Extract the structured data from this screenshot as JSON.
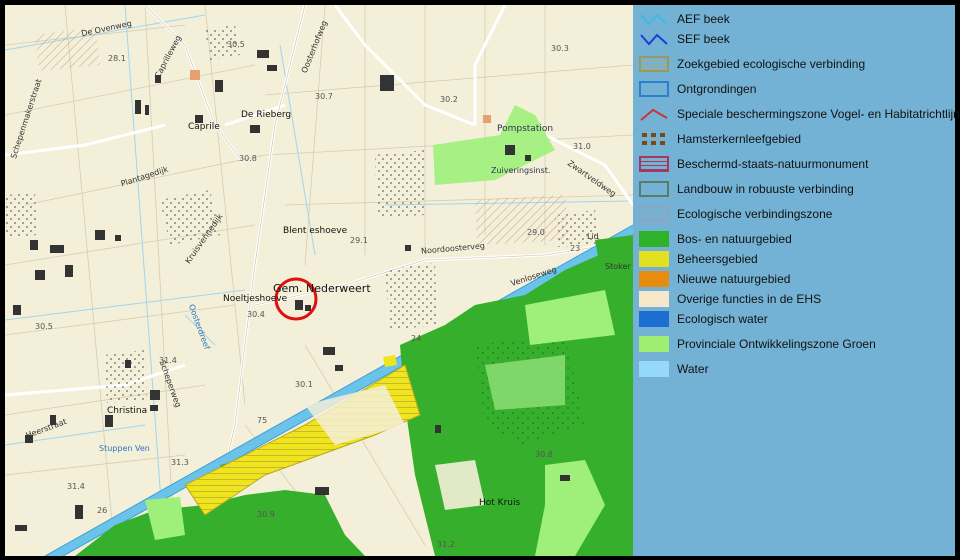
{
  "map": {
    "place_labels": [
      {
        "id": "ovenweg",
        "text": "De Ovenweg"
      },
      {
        "id": "caprilleweg",
        "text": "Caprilleweg"
      },
      {
        "id": "oosterhofweg",
        "text": "Oosterhofweg"
      },
      {
        "id": "schepenmakerstraat",
        "text": "Schepenmakerstraat"
      },
      {
        "id": "caprile",
        "text": "Caprile"
      },
      {
        "id": "rieberg",
        "text": "De Rieberg"
      },
      {
        "id": "pompstation",
        "text": "Pompstation"
      },
      {
        "id": "zuiverigs",
        "text": "Zuiveringsinst."
      },
      {
        "id": "zwartveld",
        "text": "Zwartveldweg"
      },
      {
        "id": "plantagedijk",
        "text": "Plantagedijk"
      },
      {
        "id": "blenteshoeve",
        "text": "Blent eshoeve"
      },
      {
        "id": "noordoosterveg",
        "text": "Noordoosterveg"
      },
      {
        "id": "kruisvennedijk",
        "text": "Kruisvennedijk"
      },
      {
        "id": "noeltjeshoeve",
        "text": "Noeltjeshoeve"
      },
      {
        "id": "venlosesweg",
        "text": "Venloseweg"
      },
      {
        "id": "stokers",
        "text": "Stoker"
      },
      {
        "id": "oosterdreef",
        "text": "Oosterdreef"
      },
      {
        "id": "scheperweg",
        "text": "Scheperweg"
      },
      {
        "id": "christina",
        "text": "Christina"
      },
      {
        "id": "stuppen",
        "text": "Stuppen Ven"
      },
      {
        "id": "hotkruis",
        "text": "Hot Kruis"
      },
      {
        "id": "heerstraat",
        "text": "Heerstraat"
      },
      {
        "id": "lid",
        "text": "Lid"
      }
    ],
    "elevations": [
      "28.1",
      "30.5",
      "30.7",
      "30.2",
      "30.3",
      "31.0",
      "30.8",
      "29.1",
      "29.0",
      "23",
      "30.4",
      "30.5",
      "31.4",
      "30.1",
      "24",
      "75",
      "31.3",
      "31.4",
      "26",
      "30.9",
      "31.2",
      "30.8"
    ],
    "marked_place": "Gem. Nederweert"
  },
  "legend": {
    "items": [
      {
        "key": "aef",
        "label": "AEF beek",
        "color": "#3db8ea"
      },
      {
        "key": "sef",
        "label": "SEF beek",
        "color": "#1d3fd0"
      },
      {
        "key": "zoek",
        "label": "Zoekgebied ecologische verbinding",
        "color": "#9a9a58"
      },
      {
        "key": "ontgr",
        "label": "Ontgrondingen",
        "color": "#2b7fd0"
      },
      {
        "key": "speciale",
        "label": "Speciale beschermingszone Vogel- en Habitatrichtlijn",
        "color": "#cc3333"
      },
      {
        "key": "hamster",
        "label": "Hamsterkernleefgebied",
        "color": "#7a4a12"
      },
      {
        "key": "beschermd",
        "label": "Beschermd-staats-natuurmonument",
        "color": "#a8385a"
      },
      {
        "key": "landbouw",
        "label": "Landbouw in robuuste verbinding",
        "color": "#5c7a64"
      },
      {
        "key": "ecozone",
        "label": "Ecologische verbindingszone",
        "color": "#8aa6c2"
      },
      {
        "key": "bos",
        "label": "Bos- en natuurgebied",
        "color": "#2fb22a"
      },
      {
        "key": "beheer",
        "label": "Beheersgebied",
        "color": "#e2e020"
      },
      {
        "key": "nieuw",
        "label": "Nieuwe natuurgebied",
        "color": "#e88c10"
      },
      {
        "key": "overig",
        "label": "Overige functies in de EHS",
        "color": "#f6e8c8"
      },
      {
        "key": "ecowater",
        "label": "Ecologisch water",
        "color": "#1a6fd0"
      },
      {
        "key": "pog",
        "label": "Provinciale Ontwikkelingszone Groen",
        "color": "#9eee72"
      },
      {
        "key": "water",
        "label": "Water",
        "color": "#96d8f8"
      }
    ]
  }
}
